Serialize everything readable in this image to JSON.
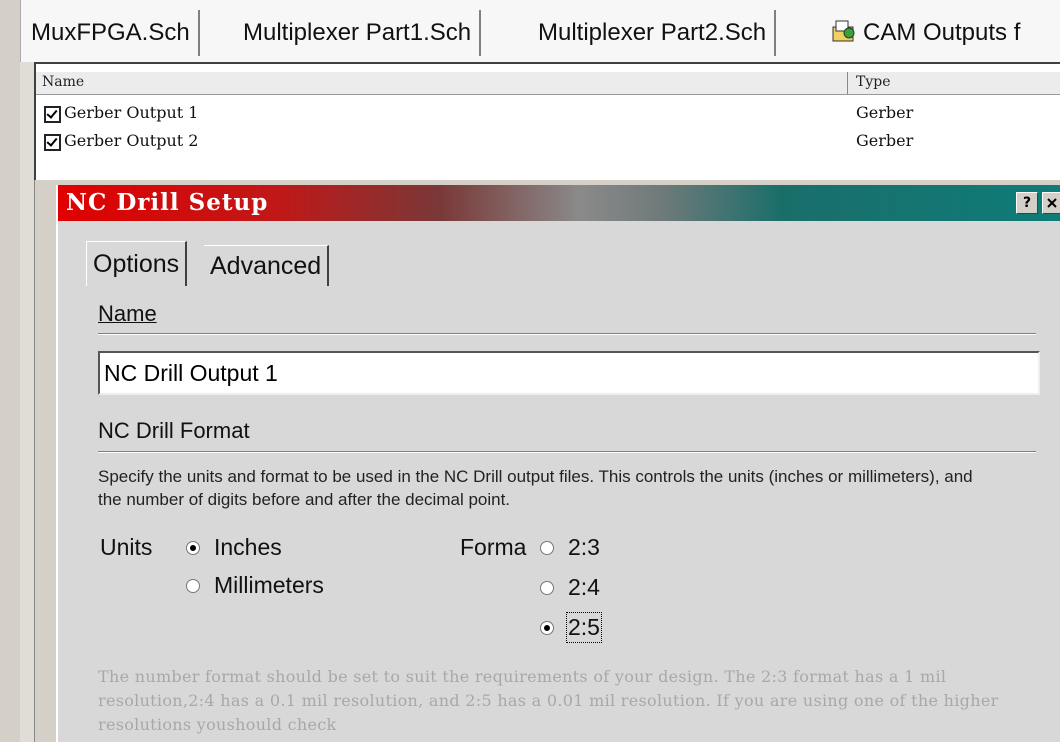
{
  "editor_tabs": [
    {
      "label": "MuxFPGA.Sch"
    },
    {
      "label": "Multiplexer Part1.Sch"
    },
    {
      "label": "Multiplexer Part2.Sch"
    },
    {
      "label": "CAM Outputs f",
      "icon": "cam-outputs-icon"
    }
  ],
  "cam_list": {
    "headers": {
      "name": "Name",
      "type": "Type"
    },
    "rows": [
      {
        "name": "Gerber Output 1",
        "type": "Gerber",
        "checked": true
      },
      {
        "name": "Gerber Output 2",
        "type": "Gerber",
        "checked": true
      }
    ]
  },
  "dialog": {
    "title": "NC Drill Setup",
    "help_button": "?",
    "tabs": [
      {
        "label": "Options"
      },
      {
        "label": "Advanced"
      }
    ],
    "name_section": {
      "header": "Name",
      "value": "NC Drill Output 1"
    },
    "format_section": {
      "header": "NC Drill Format",
      "description": "Specify the units and format to be used in the NC Drill output files. This controls the units (inches or millimeters), and the number of digits before and after the decimal point.",
      "units_label": "Units",
      "units_options": [
        {
          "label": "Inches",
          "selected": true
        },
        {
          "label": "Millimeters",
          "selected": false
        }
      ],
      "format_label": "Forma",
      "format_options": [
        {
          "label": "2:3",
          "selected": false
        },
        {
          "label": "2:4",
          "selected": false
        },
        {
          "label": "2:5",
          "selected": true
        }
      ],
      "note": "The number format should be set to suit the requirements of your design. The 2:3 format has a 1 mil resolution,2:4 has a 0.1 mil resolution, and 2:5 has a 0.01 mil resolution. If you are using one of the higher resolutions youshould check"
    }
  }
}
